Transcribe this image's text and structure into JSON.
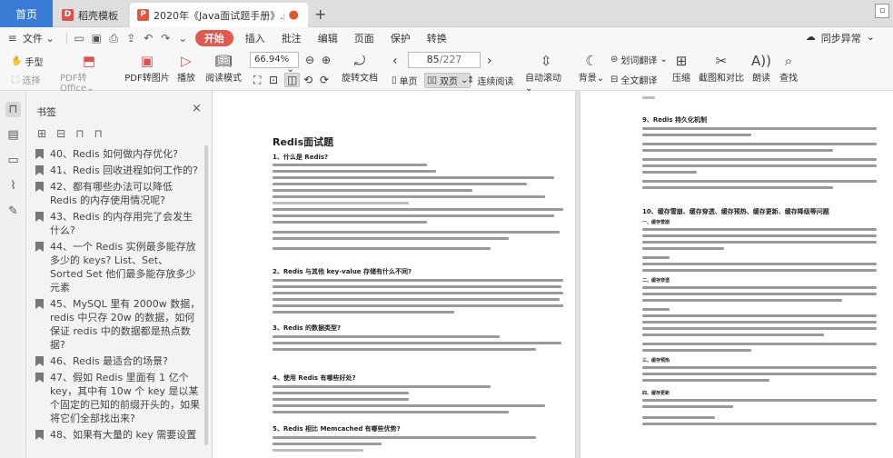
{
  "tabs": {
    "home": "首页",
    "template": "稻壳模板",
    "document": "2020年《Java面试题手册》.pdf",
    "add": "+"
  },
  "menu": {
    "file": "文件",
    "start": "开始",
    "items": [
      "插入",
      "批注",
      "编辑",
      "页面",
      "保护",
      "转换"
    ],
    "sync": "同步异常"
  },
  "toolbar": {
    "hand": "手型",
    "select": "选择",
    "pdf_to_office": "PDF转Office",
    "pdf_to_image": "PDF转图片",
    "play": "播放",
    "reading_mode": "阅读模式",
    "zoom": "66.94%",
    "rotate": "旋转文档",
    "page_current": "85",
    "page_total": "/227",
    "single_page": "单页",
    "double_page": "双页",
    "continuous": "连续阅读",
    "auto_scroll": "自动滚动",
    "background": "背景",
    "translate_word": "划词翻译",
    "translate_full": "全文翻译",
    "compress": "压缩",
    "screenshot_compare": "截图和对比",
    "read_aloud": "朗读",
    "find": "查找"
  },
  "sidebar": {
    "title": "书签",
    "bookmarks": [
      "40、Redis 如何做内存优化?",
      "41、Redis 回收进程如何工作的?",
      "42、都有哪些办法可以降低 Redis 的内存使用情况呢?",
      "43、Redis 的内存用完了会发生什么?",
      "44、一个 Redis 实例最多能存放多少的 keys? List、Set、Sorted Set 他们最多能存放多少元素",
      "45、MySQL 里有 2000w 数据，redis 中只存 20w 的数据，如何保证 redis 中的数据都是热点数据?",
      "46、Redis 最适合的场景?",
      "47、假如 Redis 里面有 1 亿个 key，其中有 10w 个 key 是以某个固定的已知的前缀开头的，如果将它们全部找出来?",
      "48、如果有大量的 key 需要设置"
    ]
  },
  "doc_left": {
    "title": "Redis面试题",
    "q1": "1、什么是 Redis?",
    "q2": "2、Redis 与其他 key-value 存储有什么不同?",
    "q3": "3、Redis 的数据类型?",
    "q4": "4、使用 Redis 有哪些好处?",
    "q5": "5、Redis 相比 Memcached 有哪些优势?"
  },
  "doc_right": {
    "q9": "9、Redis 持久化机制",
    "q10": "10、缓存雪崩、缓存穿透、缓存预热、缓存更新、缓存降级等问题",
    "s1": "一、缓存雪崩",
    "s2": "二、缓存穿透",
    "s3": "三、缓存预热",
    "s4": "四、缓存更新"
  },
  "colors": {
    "accent_blue": "#3a7bd5",
    "start_red": "#e05a4f"
  }
}
